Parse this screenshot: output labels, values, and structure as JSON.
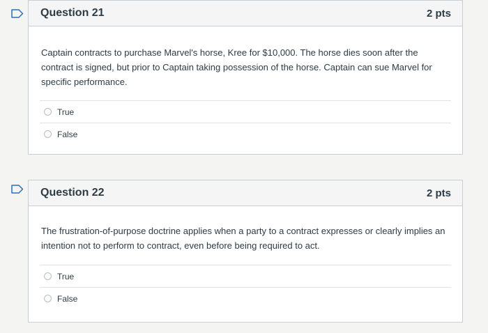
{
  "questions": [
    {
      "title": "Question 21",
      "points": "2 pts",
      "text": "Captain contracts to purchase Marvel's horse, Kree for $10,000. The horse dies soon after the contract is signed, but prior to Captain taking possession of the horse. Captain can sue Marvel for specific performance.",
      "answers": [
        "True",
        "False"
      ]
    },
    {
      "title": "Question 22",
      "points": "2 pts",
      "text": "The frustration-of-purpose doctrine applies when a party to a contract expresses or clearly implies an intention not to perform to contract, even before being required to act.",
      "answers": [
        "True",
        "False"
      ]
    }
  ],
  "colors": {
    "flag_stroke": "#2d6fb7",
    "border": "#c7cdd1",
    "header_bg": "#f5f5f5",
    "text": "#2d3b45"
  },
  "icons": {
    "flag": "flag-question-icon",
    "radio": "radio-unselected-icon"
  }
}
